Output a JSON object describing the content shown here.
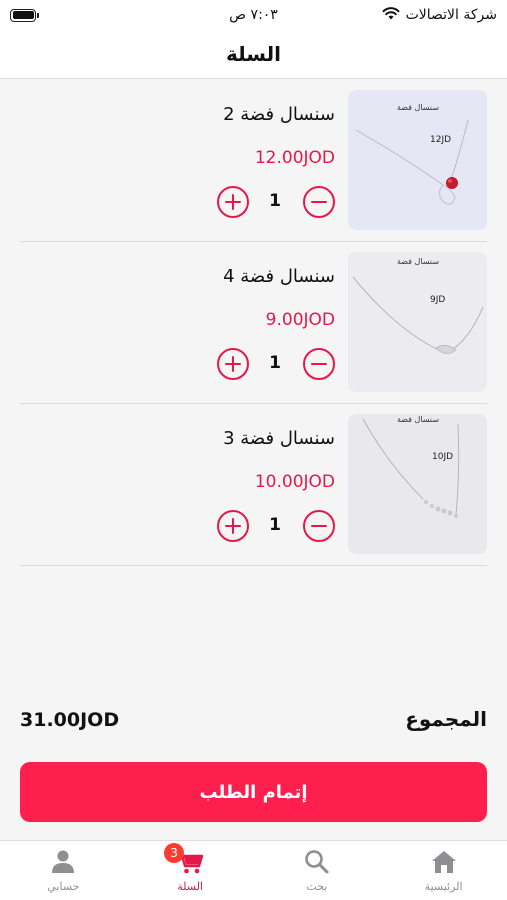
{
  "status_bar": {
    "carrier": "شركة الاتصالات",
    "time": "٧:٠٣ ص"
  },
  "header": {
    "title": "السلة"
  },
  "cart": {
    "items": [
      {
        "name": "سنسال فضة 2",
        "price": "12.00JOD",
        "quantity": "1",
        "image_caption": "سنسال فضة",
        "image_price": "12JD"
      },
      {
        "name": "سنسال فضة 4",
        "price": "9.00JOD",
        "quantity": "1",
        "image_caption": "سنسال فضة",
        "image_price": "9JD"
      },
      {
        "name": "سنسال فضة 3",
        "price": "10.00JOD",
        "quantity": "1",
        "image_caption": "سنسال فضة",
        "image_price": "10JD"
      }
    ]
  },
  "summary": {
    "total_label": "المجموع",
    "total_value": "31.00JOD",
    "checkout_label": "إتمام الطلب"
  },
  "tabbar": {
    "tabs": [
      {
        "label": "حسابي",
        "icon": "person-icon"
      },
      {
        "label": "السلة",
        "icon": "cart-icon",
        "badge": "3",
        "active": true
      },
      {
        "label": "بحث",
        "icon": "search-icon"
      },
      {
        "label": "الرئيسية",
        "icon": "home-icon"
      }
    ]
  },
  "colors": {
    "accent": "#e8174a",
    "checkout_button": "#ff1f4e",
    "badge": "#ff3b30",
    "inactive_tab": "#8e8e93"
  }
}
